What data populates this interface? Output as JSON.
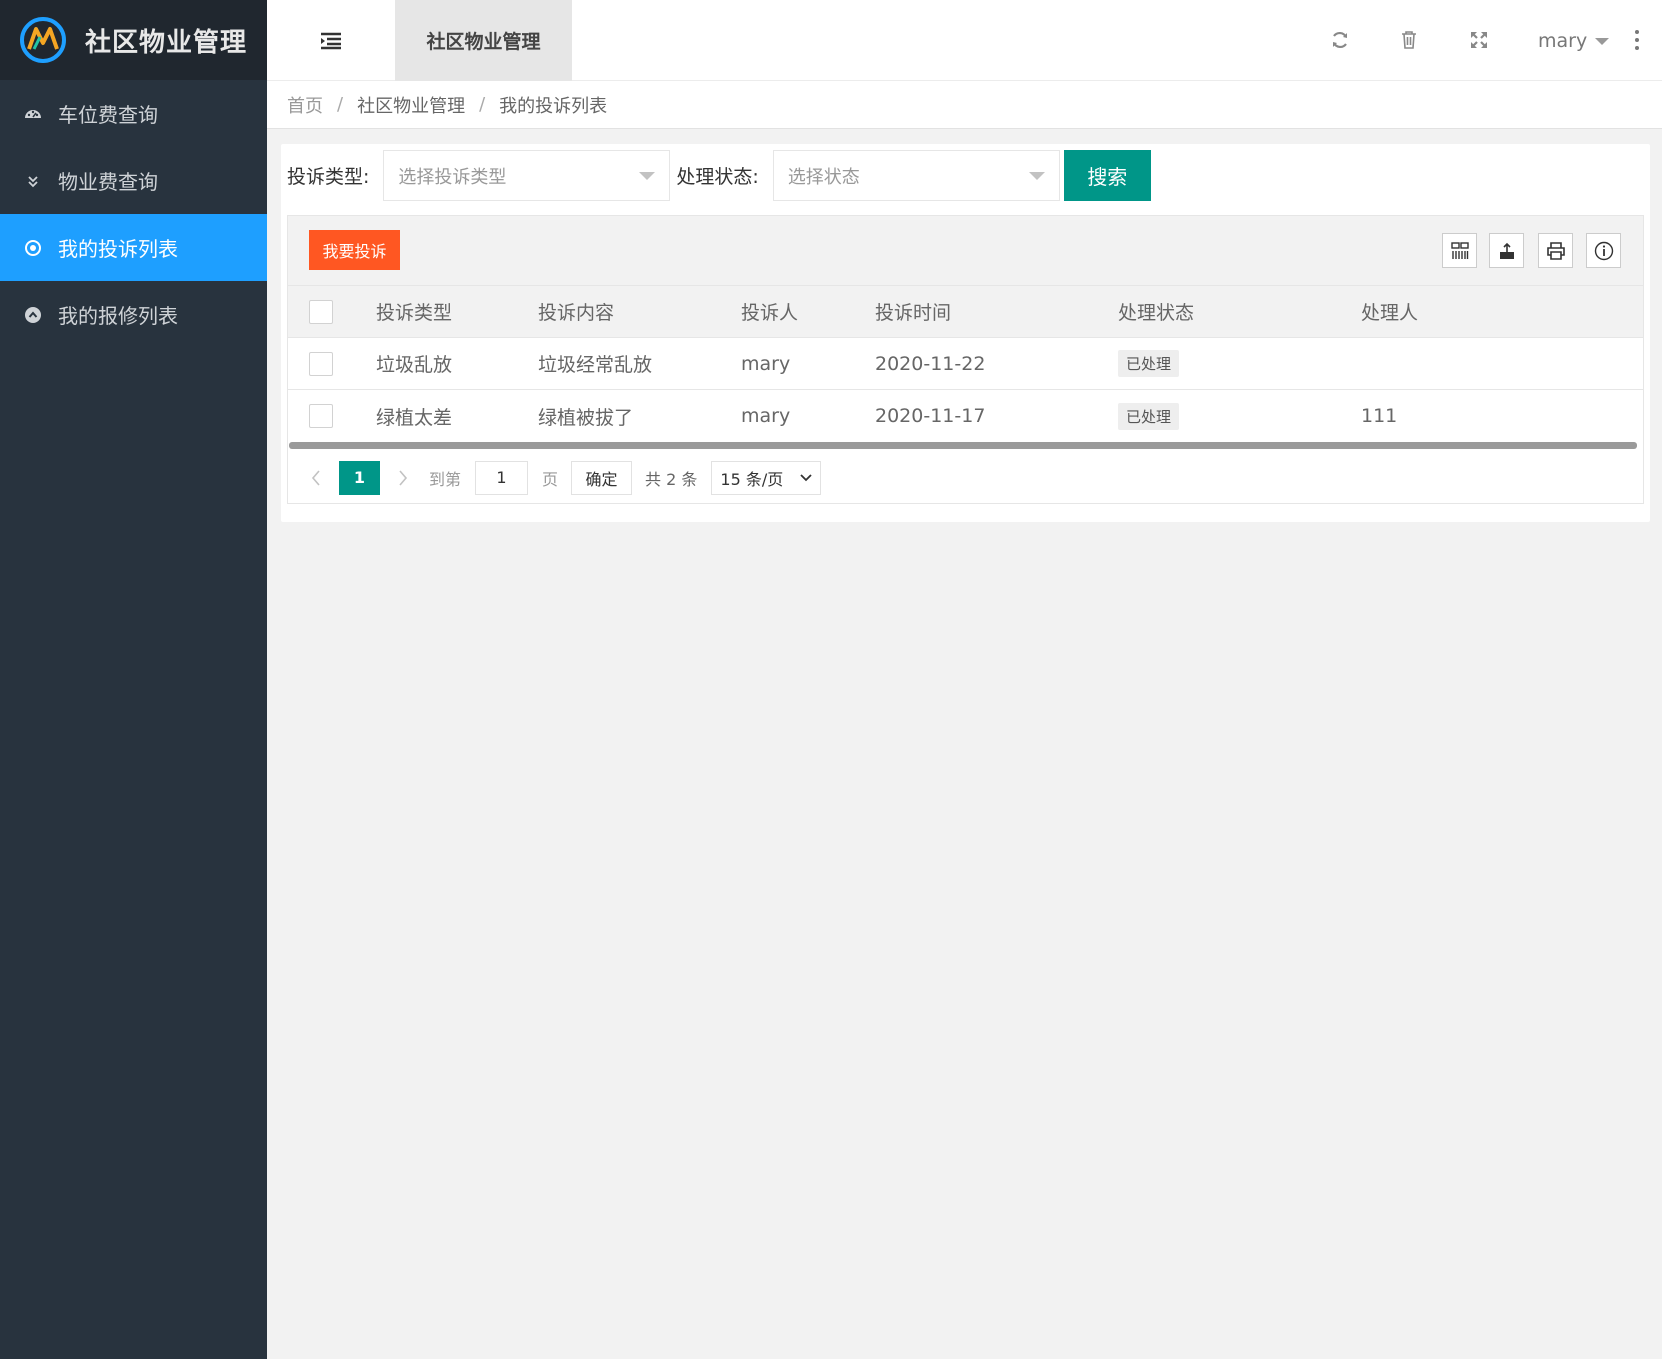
{
  "app": {
    "title": "社区物业管理",
    "accent_color": "#1e9fff",
    "primary_color": "#009688",
    "danger_color": "#ff5722"
  },
  "sidebar": {
    "items": [
      {
        "label": "车位费查询",
        "icon": "dashboard-icon",
        "active": false
      },
      {
        "label": "物业费查询",
        "icon": "double-chevron-down-icon",
        "active": false
      },
      {
        "label": "我的投诉列表",
        "icon": "radio-circle-icon",
        "active": true
      },
      {
        "label": "我的报修列表",
        "icon": "chevron-up-circle-icon",
        "active": false
      }
    ]
  },
  "header": {
    "tab_label": "社区物业管理",
    "user_name": "mary",
    "icons": [
      "menu-toggle-icon",
      "refresh-icon",
      "trash-icon",
      "fullscreen-icon",
      "more-vertical-icon"
    ]
  },
  "breadcrumb": {
    "home": "首页",
    "section": "社区物业管理",
    "current": "我的投诉列表"
  },
  "search": {
    "type_label": "投诉类型:",
    "type_placeholder": "选择投诉类型",
    "status_label": "处理状态:",
    "status_placeholder": "选择状态",
    "search_button": "搜索"
  },
  "toolbar": {
    "complain_button": "我要投诉",
    "tools": [
      "columns-icon",
      "export-icon",
      "print-icon",
      "info-icon"
    ]
  },
  "table": {
    "columns": [
      "投诉类型",
      "投诉内容",
      "投诉人",
      "投诉时间",
      "处理状态",
      "处理人"
    ],
    "rows": [
      {
        "type": "垃圾乱放",
        "content": "垃圾经常乱放",
        "person": "mary",
        "time": "2020-11-22",
        "status": "已处理",
        "handler": ""
      },
      {
        "type": "绿植太差",
        "content": "绿植被拔了",
        "person": "mary",
        "time": "2020-11-17",
        "status": "已处理",
        "handler": "111"
      }
    ]
  },
  "pager": {
    "current_page": "1",
    "goto_label": "到第",
    "page_input": "1",
    "page_unit": "页",
    "confirm": "确定",
    "total": "共 2 条",
    "page_size": "15 条/页"
  }
}
